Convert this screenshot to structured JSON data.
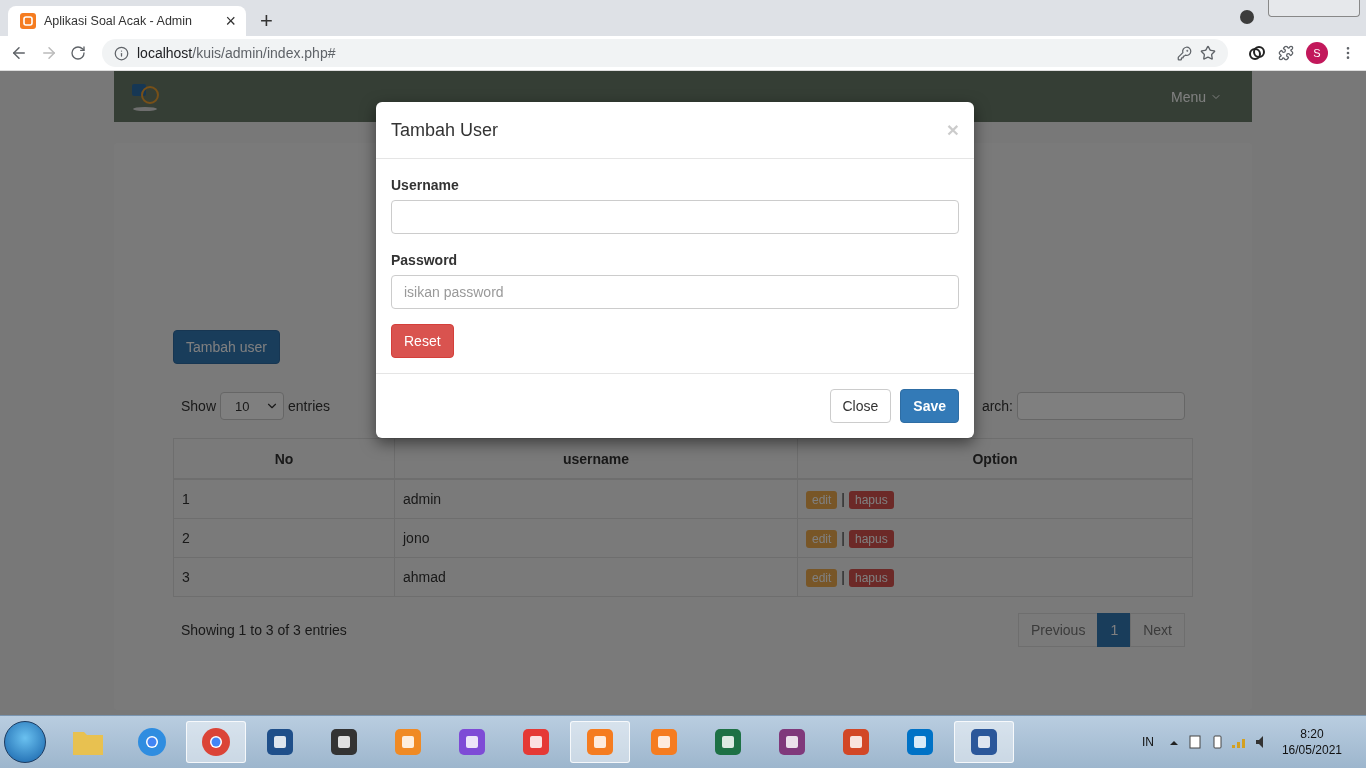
{
  "browser": {
    "tab_title": "Aplikasi Soal Acak - Admin",
    "tab_close": "×",
    "new_tab": "+",
    "url_host": "localhost",
    "url_path": "/kuis/admin/index.php#",
    "profile": "S"
  },
  "navbar": {
    "menu": "Menu"
  },
  "content": {
    "add_button": "Tambah user",
    "show_label": "Show",
    "length": "10",
    "entries_label": "entries",
    "search_label": "arch:",
    "table": {
      "columns": [
        "No",
        "username",
        "Option"
      ],
      "rows": [
        {
          "no": "1",
          "username": "admin",
          "edit": "edit",
          "sep": "|",
          "delete": "hapus"
        },
        {
          "no": "2",
          "username": "jono",
          "edit": "edit",
          "sep": "|",
          "delete": "hapus"
        },
        {
          "no": "3",
          "username": "ahmad",
          "edit": "edit",
          "sep": "|",
          "delete": "hapus"
        }
      ]
    },
    "info": "Showing 1 to 3 of 3 entries",
    "pagination": [
      {
        "label": "Previous",
        "selected": false
      },
      {
        "label": "1",
        "selected": true
      },
      {
        "label": "Next",
        "selected": false
      }
    ]
  },
  "modal": {
    "title": "Tambah User",
    "close": "×",
    "fields": [
      {
        "label": "Username"
      },
      {
        "label": "Password",
        "placeholder": "isikan password"
      }
    ],
    "reset": "Reset",
    "buttons": [
      {
        "label": "Close",
        "kind": "default"
      },
      {
        "label": "Save",
        "kind": "primary"
      }
    ]
  },
  "taskbar": {
    "apps": [
      {
        "kind": "folder",
        "selected": false
      },
      {
        "kind": "ie",
        "selected": false
      },
      {
        "kind": "chrome",
        "selected": true
      },
      {
        "kind": "maxthon",
        "selected": false
      },
      {
        "kind": "inkscape",
        "selected": false
      },
      {
        "kind": "media",
        "selected": false
      },
      {
        "kind": "vs",
        "selected": false
      },
      {
        "kind": "recorder",
        "selected": false
      },
      {
        "kind": "xampp",
        "selected": true
      },
      {
        "kind": "xampp",
        "selected": false
      },
      {
        "kind": "excel",
        "selected": false
      },
      {
        "kind": "onenote",
        "selected": false
      },
      {
        "kind": "powerpoint",
        "selected": false
      },
      {
        "kind": "outlook",
        "selected": false
      },
      {
        "kind": "word",
        "selected": true
      }
    ],
    "language": "IN",
    "time": "8:20",
    "date": "16/05/2021"
  }
}
